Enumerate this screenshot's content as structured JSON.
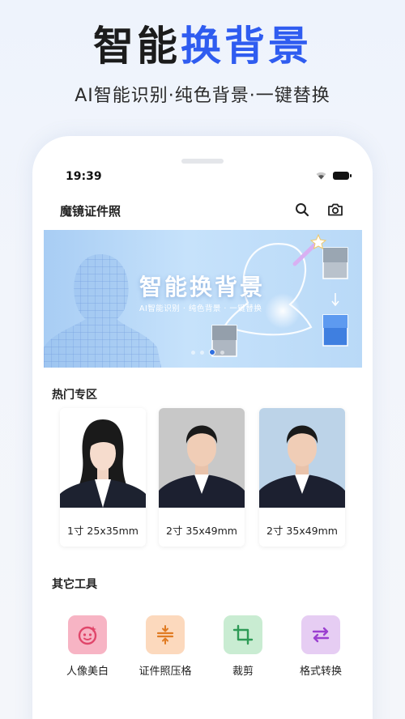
{
  "hero": {
    "title_part1": "智能",
    "title_part2": "换背景",
    "subtitle": "AI智能识别·纯色背景·一键替换"
  },
  "status_bar": {
    "time": "19:39"
  },
  "header": {
    "app_title": "魔镜证件照",
    "icons": [
      "search-icon",
      "camera-icon"
    ]
  },
  "banner": {
    "title": "智能换背景",
    "subtitle": "AI智能识别 · 纯色背景 · 一键替换",
    "active_slide": 3,
    "slide_count": 4
  },
  "hot_section": {
    "title": "热门专区",
    "cards": [
      {
        "label": "1寸  25x35mm",
        "background": "#ffffff"
      },
      {
        "label": "2寸  35x49mm",
        "background": "#c8c8c8"
      },
      {
        "label": "2寸  35x49mm",
        "background": "#bcd3e8"
      }
    ]
  },
  "tools_section": {
    "title": "其它工具",
    "tools": [
      {
        "label": "人像美白",
        "icon": "face-icon",
        "color": "#f7b4c4"
      },
      {
        "label": "证件照压格",
        "icon": "compress-icon",
        "color": "#fcd9bd"
      },
      {
        "label": "裁剪",
        "icon": "crop-icon",
        "color": "#c9ecd2"
      },
      {
        "label": "格式转换",
        "icon": "swap-icon",
        "color": "#e6cdf3"
      }
    ]
  },
  "colors": {
    "accent": "#2f5cf0",
    "dark": "#1c1c1c"
  }
}
